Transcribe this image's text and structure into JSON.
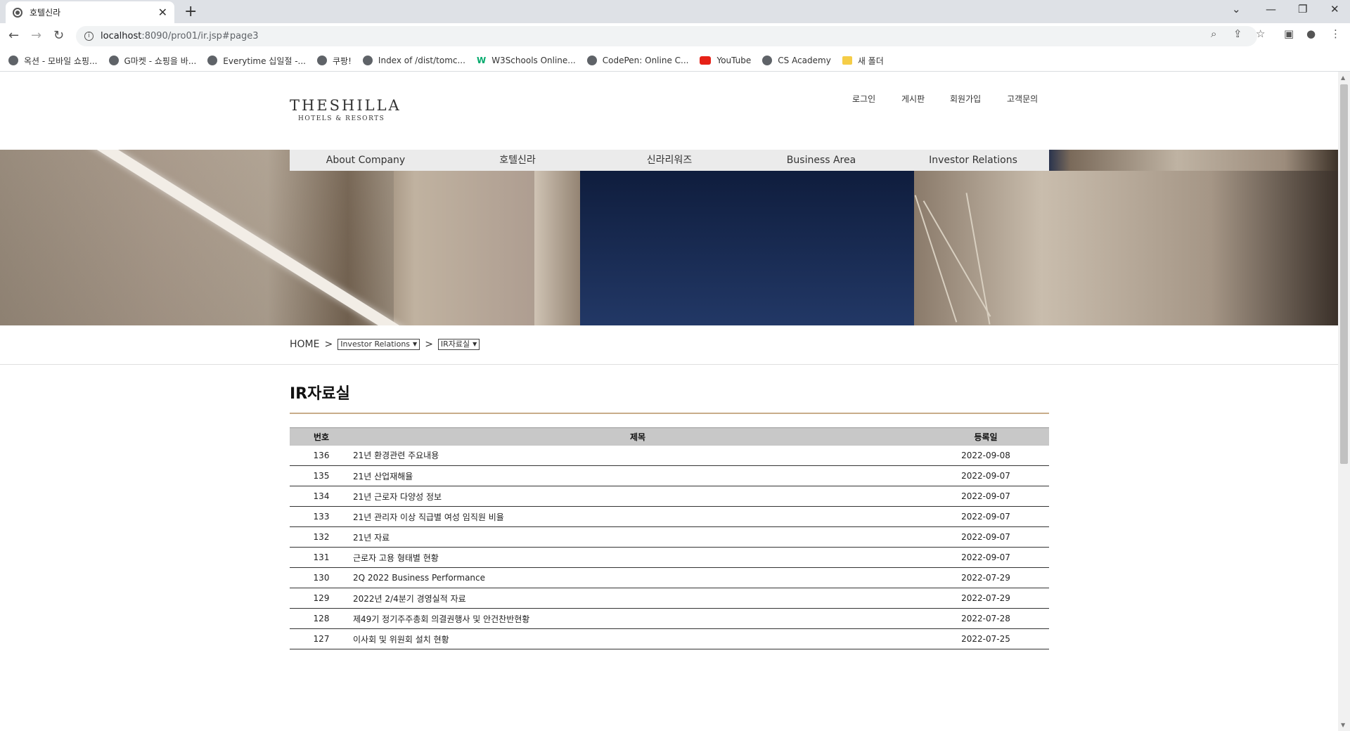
{
  "browser": {
    "tab_title": "호텔신라",
    "url_host": "localhost",
    "url_path": ":8090/pro01/ir.jsp#page3",
    "bookmarks": [
      {
        "label": "옥션 - 모바일 쇼핑...",
        "icon": "globe-icon"
      },
      {
        "label": "G마켓 - 쇼핑을 바...",
        "icon": "globe-icon"
      },
      {
        "label": "Everytime 십일절 -...",
        "icon": "globe-icon"
      },
      {
        "label": "쿠팡!",
        "icon": "globe-icon"
      },
      {
        "label": "Index of /dist/tomc...",
        "icon": "globe-icon"
      },
      {
        "label": "W3Schools Online...",
        "icon": "w3schools-icon"
      },
      {
        "label": "CodePen: Online C...",
        "icon": "codepen-icon"
      },
      {
        "label": "YouTube",
        "icon": "youtube-icon"
      },
      {
        "label": "CS Academy",
        "icon": "cs-academy-icon"
      },
      {
        "label": "새 폴더",
        "icon": "folder-icon"
      }
    ]
  },
  "header": {
    "logo_main": "THESHILLA",
    "logo_sub": "HOTELS & RESORTS",
    "util": [
      "로그인",
      "게시판",
      "회원가입",
      "고객문의"
    ]
  },
  "gnb": [
    "About Company",
    "호텔신라",
    "신라리워즈",
    "Business Area",
    "Investor Relations"
  ],
  "breadcrumb": {
    "home": "HOME",
    "sep": ">",
    "level1": "Investor Relations",
    "level2": "IR자료실"
  },
  "page_title": "IR자료실",
  "table": {
    "headers": {
      "no": "번호",
      "title": "제목",
      "date": "등록일"
    },
    "rows": [
      {
        "no": "136",
        "title": "21년 환경관련 주요내용",
        "date": "2022-09-08"
      },
      {
        "no": "135",
        "title": "21년 산업재해율",
        "date": "2022-09-07"
      },
      {
        "no": "134",
        "title": "21년 근로자 다양성 정보",
        "date": "2022-09-07"
      },
      {
        "no": "133",
        "title": "21년 관리자 이상 직급별 여성 임직원 비율",
        "date": "2022-09-07"
      },
      {
        "no": "132",
        "title": "21년 자료",
        "date": "2022-09-07"
      },
      {
        "no": "131",
        "title": "근로자 고용 형태별 현황",
        "date": "2022-09-07"
      },
      {
        "no": "130",
        "title": "2Q 2022 Business Performance",
        "date": "2022-07-29"
      },
      {
        "no": "129",
        "title": "2022년 2/4분기 경영실적 자료",
        "date": "2022-07-29"
      },
      {
        "no": "128",
        "title": "제49기 정기주주총회 의결권행사 및 안건찬반현황",
        "date": "2022-07-28"
      },
      {
        "no": "127",
        "title": "이사회 및 위원회 설치 현황",
        "date": "2022-07-25"
      }
    ]
  },
  "colors": {
    "accent_line": "#c8ad8a",
    "table_header": "#c8c8c8",
    "gnb_bg": "#ebebeb"
  }
}
